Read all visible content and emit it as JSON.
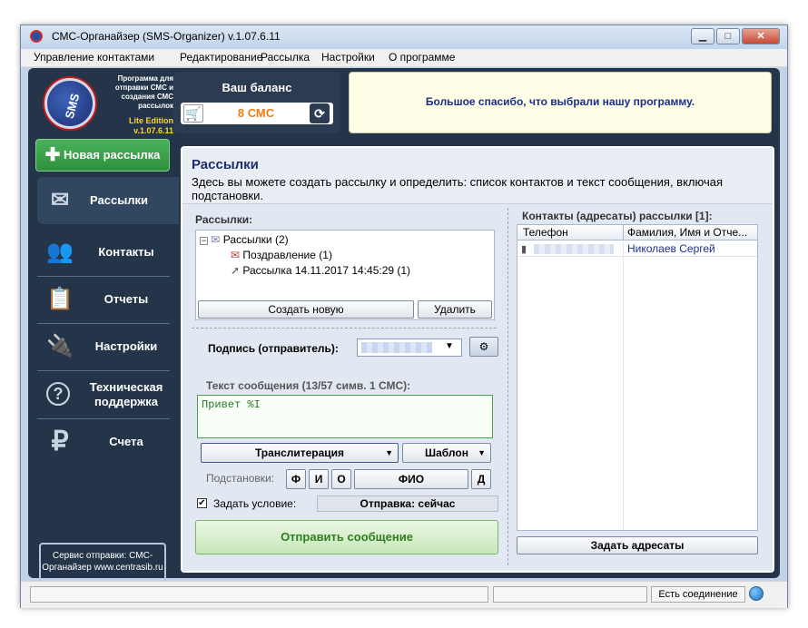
{
  "window": {
    "title": "СМС-Органайзер (SMS-Organizer) v.1.07.6.11"
  },
  "menu": [
    "Управление контактами",
    "Редактирование",
    "Рассылка",
    "Настройки",
    "О программе"
  ],
  "logo": {
    "text": "SMS",
    "description": "Программа для отправки СМС и создания СМС рассылок",
    "edition": "Lite Edition",
    "version": "v.1.07.6.11"
  },
  "balance": {
    "title": "Ваш баланс",
    "value": "8 СМС"
  },
  "banner": {
    "text": "Большое спасибо, что выбрали нашу программу."
  },
  "sidebar": {
    "new_button": "Новая рассылка",
    "items": [
      {
        "label": "Рассылки",
        "icon": "envelope-icon"
      },
      {
        "label": "Контакты",
        "icon": "people-icon"
      },
      {
        "label": "Отчеты",
        "icon": "clipboard-icon"
      },
      {
        "label": "Настройки",
        "icon": "plug-icon"
      },
      {
        "label": "Техническая поддержка",
        "icon": "question-icon"
      },
      {
        "label": "Счета",
        "icon": "ruble-icon"
      }
    ],
    "service": "Сервис отправки: СМС-Органайзер www.centrasib.ru"
  },
  "content": {
    "title": "Рассылки",
    "description": "Здесь вы можете создать рассылку и определить: список контактов и текст сообщения, включая подстановки.",
    "mailings_label": "Рассылки:",
    "tree": {
      "root": "Рассылки (2)",
      "children": [
        "Поздравление (1)",
        "Рассылка 14.11.2017 14:45:29 (1)"
      ]
    },
    "create_button": "Создать новую",
    "delete_button": "Удалить",
    "signature_label": "Подпись (отправитель):",
    "message_label": "Текст сообщения (13/57 симв. 1 СМС):",
    "message_text": "Привет %I",
    "translit_button": "Транслитерация",
    "template_button": "Шаблон",
    "subst_label": "Подстановки:",
    "subst_buttons": [
      "Ф",
      "И",
      "О",
      "ФИО",
      "Д"
    ],
    "condition_label": "Задать условие:",
    "send_status": "Отправка: сейчас",
    "send_button": "Отправить сообщение",
    "contacts_label": "Контакты (адресаты) рассылки [1]:",
    "columns": [
      "Телефон",
      "Фамилия, Имя и Отче..."
    ],
    "rows": [
      {
        "phone": "",
        "name": "Николаев Сергей"
      }
    ],
    "set_recipients_button": "Задать адресаты"
  },
  "status": {
    "connection": "Есть соединение"
  }
}
